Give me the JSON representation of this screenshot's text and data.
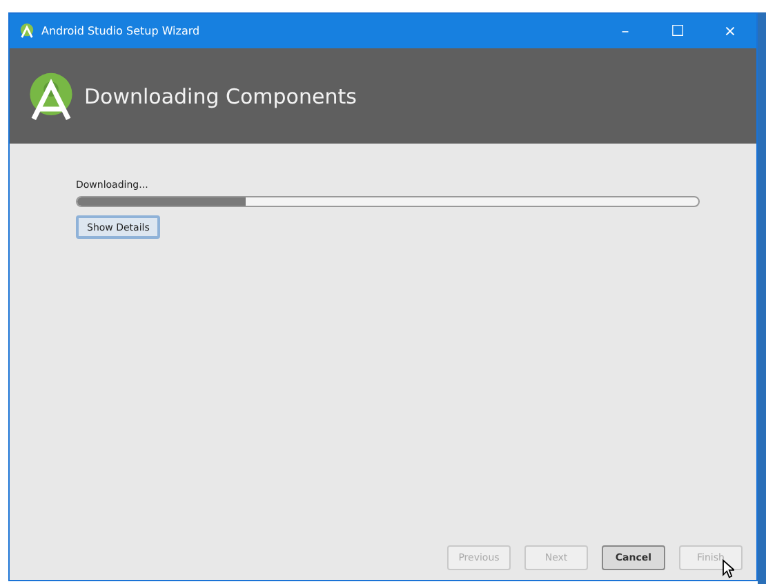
{
  "window": {
    "title": "Android Studio Setup Wizard",
    "controls": [
      "–",
      "☐",
      "×"
    ]
  },
  "header": {
    "title": "Downloading Components"
  },
  "progress": {
    "label": "Downloading...",
    "level": 0.27
  },
  "details_button": {
    "label": "Show Details",
    "focused": true
  },
  "buttons": [
    {
      "label": "Previous",
      "disabled": true,
      "default": false
    },
    {
      "label": "Next",
      "disabled": true,
      "default": false
    },
    {
      "label": "Cancel",
      "disabled": false,
      "default": true
    },
    {
      "label": "Finish",
      "disabled": true,
      "default": false
    }
  ]
}
